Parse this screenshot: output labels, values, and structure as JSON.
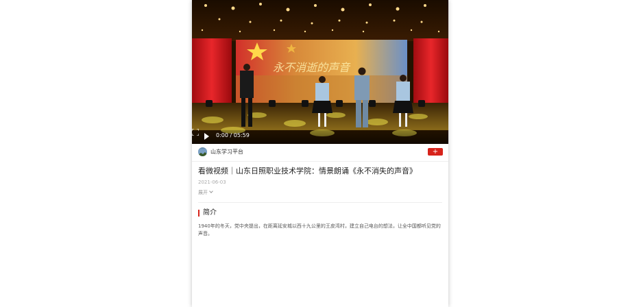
{
  "video": {
    "banner_text": "永不消逝的声音",
    "time": "0:00 / 05:59",
    "colors": {
      "stage_red": "#c8141a",
      "stage_floor": "#7a5a10",
      "screen_sky": "#4a78b8"
    }
  },
  "channel": {
    "name": "山东学习平台",
    "follow_label": "+"
  },
  "article": {
    "title": "看微视频｜山东日照职业技术学院：情景朗诵《永不消失的声音》",
    "date": "2021-06-03",
    "expand_label": "展开"
  },
  "summary": {
    "heading": "简介",
    "text": "1940年的冬天，党中央提出，在距离延安城以西十九公里的王皮湾村，建立自己电台的想法，让全中国都听见党的声音。"
  },
  "colors": {
    "accent": "#d7231b"
  }
}
